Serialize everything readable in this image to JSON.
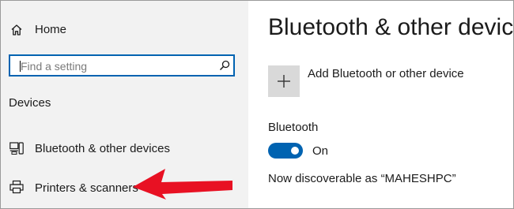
{
  "sidebar": {
    "home_label": "Home",
    "search_placeholder": "Find a setting",
    "section_title": "Devices",
    "items": [
      {
        "label": "Bluetooth & other devices",
        "icon": "bluetooth-devices-icon"
      },
      {
        "label": "Printers & scanners",
        "icon": "printer-icon"
      }
    ]
  },
  "main": {
    "title": "Bluetooth & other devices",
    "add_device_label": "Add Bluetooth or other device",
    "bluetooth_label": "Bluetooth",
    "toggle_state": "On",
    "discoverable_text": "Now discoverable as “MAHESHPC”"
  },
  "annotation": {
    "type": "arrow",
    "color": "#e81123",
    "points_to": "Printers & scanners"
  },
  "colors": {
    "accent": "#0063b1",
    "sidebar_bg": "#f2f2f2",
    "tile_bg": "#d9d9d9",
    "annotation": "#e81123"
  },
  "icons": [
    "home-icon",
    "search-icon",
    "bluetooth-devices-icon",
    "printer-icon",
    "plus-icon"
  ]
}
